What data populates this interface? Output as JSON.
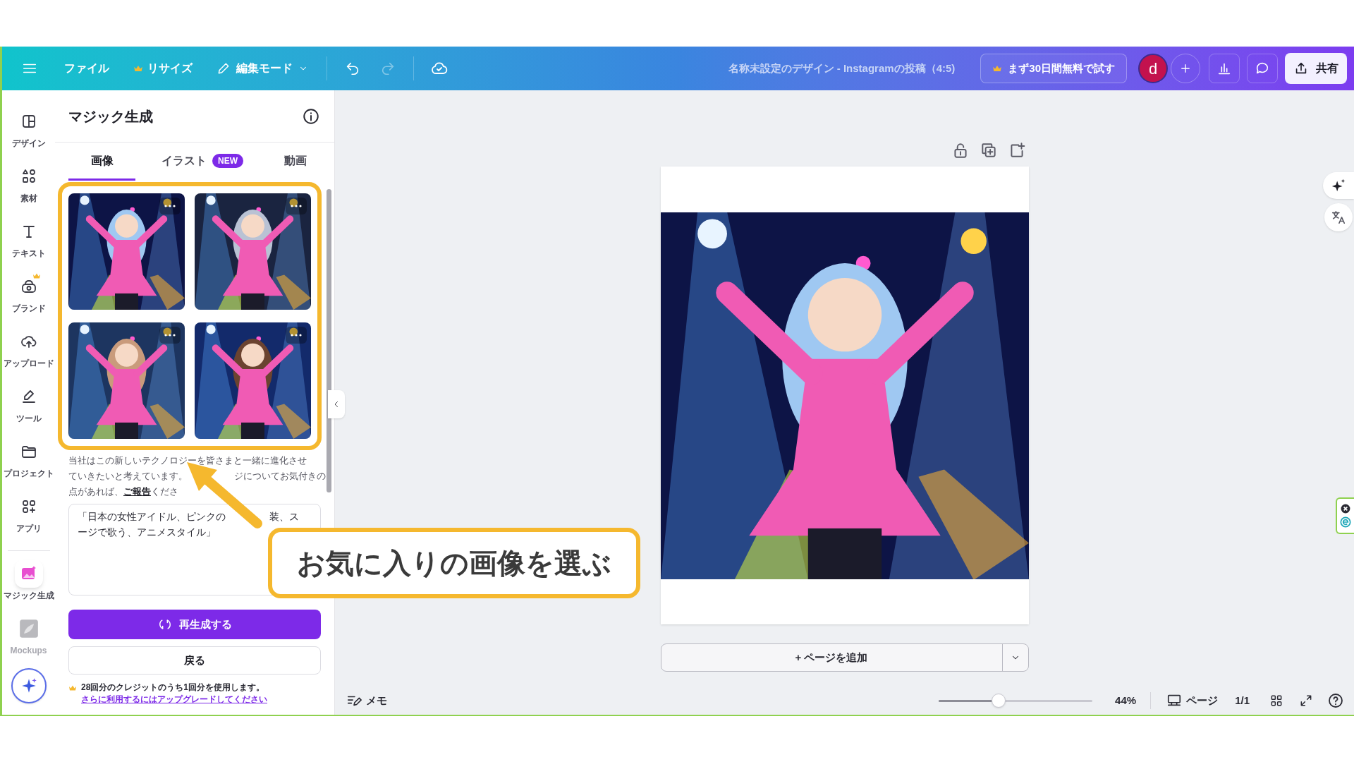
{
  "top_bar": {
    "menu": [
      {
        "label": "ファイル",
        "crown": false
      },
      {
        "label": "リサイズ",
        "crown": true
      }
    ],
    "edit_mode": "編集モード",
    "undo_disabled": false,
    "redo_disabled": true,
    "title": "名称未設定のデザイン - Instagramの投稿（4:5)",
    "trial_button": "まず30日間無料で試す",
    "avatar": "d",
    "share_button": "共有"
  },
  "rail": {
    "main": [
      {
        "kind": "layout",
        "label": "デザイン",
        "selected": false,
        "crown": false,
        "disabled": false
      },
      {
        "kind": "shapes",
        "label": "素材",
        "selected": false,
        "crown": false,
        "disabled": false
      },
      {
        "kind": "text",
        "label": "テキスト",
        "selected": false,
        "crown": false,
        "disabled": false
      },
      {
        "kind": "brand",
        "label": "ブランド",
        "selected": false,
        "crown": true,
        "disabled": false
      },
      {
        "kind": "upload",
        "label": "アップロード",
        "selected": false,
        "crown": false,
        "disabled": false
      },
      {
        "kind": "tool",
        "label": "ツール",
        "selected": false,
        "crown": false,
        "disabled": false
      },
      {
        "kind": "folder",
        "label": "プロジェクト",
        "selected": false,
        "crown": false,
        "disabled": false
      },
      {
        "kind": "apps",
        "label": "アプリ",
        "selected": false,
        "crown": false,
        "disabled": false
      }
    ],
    "extras": [
      {
        "kind": "magic",
        "label": "マジック生成",
        "selected": true,
        "crown": false,
        "disabled": false
      },
      {
        "kind": "mockups",
        "label": "Mockups",
        "selected": false,
        "crown": false,
        "disabled": true
      }
    ]
  },
  "panel": {
    "title": "マジック生成",
    "tabs": [
      {
        "label": "画像",
        "selected": true
      },
      {
        "label": "イラスト",
        "badge": "NEW",
        "selected": false
      },
      {
        "label": "動画",
        "selected": false
      }
    ],
    "results": [
      {
        "kind": "picture"
      },
      {
        "kind": "picture"
      },
      {
        "kind": "picture"
      },
      {
        "kind": "picture"
      }
    ],
    "notice_lines": [
      [
        {
          "kind": "text",
          "text": "当社はこの新しいテクノロジーを皆さまと一緒に進化させ"
        }
      ],
      [
        {
          "kind": "text",
          "text": "ていきたいと考えています。"
        },
        {
          "kind": "text",
          "text": "ジについてお気付きの"
        }
      ],
      [
        {
          "kind": "text",
          "text": "点があれば、"
        },
        {
          "kind": "link",
          "text": "ご報告"
        },
        {
          "kind": "text",
          "text": "くださ"
        }
      ]
    ],
    "prompt_lines": [
      [
        "「日本の女性アイドル、ピンクの",
        "装、ス"
      ],
      [
        "ージで歌う、アニメスタイル」"
      ]
    ],
    "regenerate_button": "再生成する",
    "back_button": "戻る",
    "credits": {
      "text": "28回分のクレジットのうち1回分を使用します。",
      "link": "さらに利用するにはアップグレードしてください"
    }
  },
  "callout": {
    "text": "お気に入りの画像を選ぶ"
  },
  "canvas": {
    "image": {
      "kind": "picture"
    },
    "add_page_button": "+ ページを追加"
  },
  "footer": {
    "notes": "メモ",
    "zoom": {
      "level": 0.39,
      "reading": "44%"
    },
    "pages_button": "ページ",
    "page_count": "1/1"
  }
}
